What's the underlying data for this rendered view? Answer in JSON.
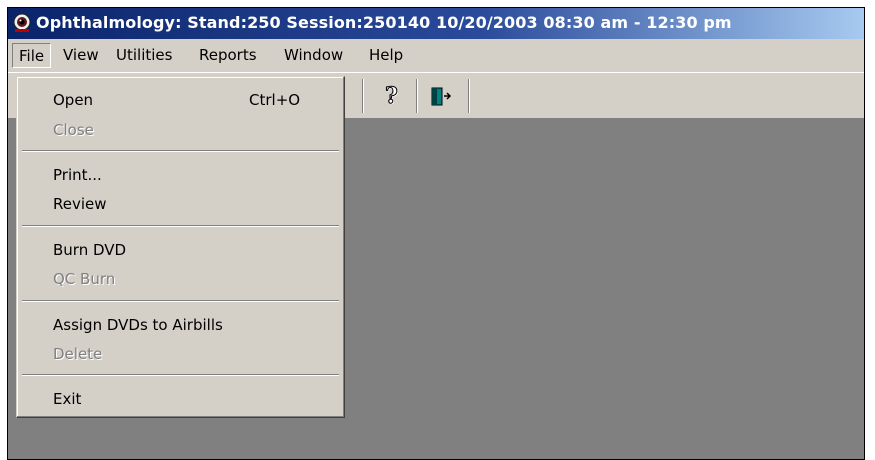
{
  "window": {
    "title": "Ophthalmology: Stand:250 Session:250140 10/20/2003 08:30 am - 12:30 pm"
  },
  "menubar": {
    "items": [
      "File",
      "View",
      "Utilities",
      "Reports",
      "Window",
      "Help"
    ],
    "active": "File"
  },
  "toolbar": {
    "buttons": [
      {
        "icon": "question-mark-help-icon"
      },
      {
        "icon": "exit-door-icon"
      }
    ]
  },
  "file_menu": {
    "open": {
      "label": "Open",
      "shortcut": "Ctrl+O",
      "enabled": true
    },
    "close": {
      "label": "Close",
      "enabled": false
    },
    "print": {
      "label": "Print...",
      "enabled": true
    },
    "review": {
      "label": "Review",
      "enabled": true
    },
    "burn_dvd": {
      "label": "Burn DVD",
      "enabled": true
    },
    "qc_burn": {
      "label": "QC Burn",
      "enabled": false
    },
    "assign_dvds": {
      "label": "Assign DVDs to Airbills",
      "enabled": true
    },
    "delete": {
      "label": "Delete",
      "enabled": false
    },
    "exit": {
      "label": "Exit",
      "enabled": true
    }
  },
  "colors": {
    "titlebar_start": "#0a246a",
    "titlebar_end": "#a6caf0",
    "chrome": "#d4d0c8",
    "workspace": "#808080",
    "disabled_text": "#808080"
  }
}
